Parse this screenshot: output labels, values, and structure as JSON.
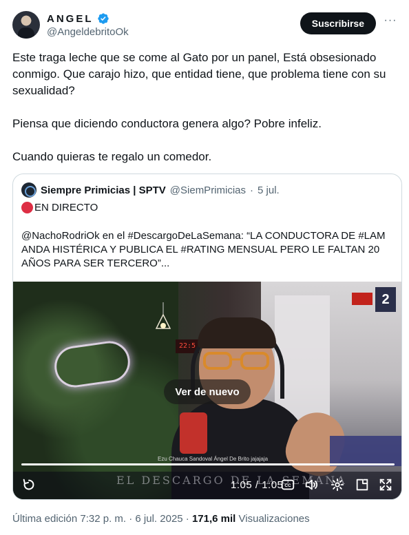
{
  "author": {
    "display_name": "ANGEL",
    "handle": "@AngeldebritoOk",
    "verified": true,
    "subscribe_label": "Suscribirse",
    "more_label": "···"
  },
  "tweet": {
    "paragraphs": [
      "Este traga leche que se come al Gato por un panel, Está obsesionado conmigo. Que carajo hizo, que entidad tiene, que problema tiene con su sexualidad?",
      "Piensa que diciendo conductora genera algo? Pobre infeliz.",
      "Cuando quieras te regalo un comedor."
    ]
  },
  "quote": {
    "name": "Siempre Primicias | SPTV",
    "handle": "@SiemPrimicias",
    "separator": "·",
    "date": "5 jul.",
    "live_label": "EN DIRECTO",
    "text": "@NachoRodriOk en el #DescargoDeLaSemana: “LA CONDUCTORA DE #LAM ANDA HISTÉRICA Y PUBLICA EL #RATING MENSUAL PERO LE FALTAN 20 AÑOS PARA SER TERCERO”...",
    "video": {
      "replay_label": "Ver de nuevo",
      "time": "1:05 / 1:05",
      "progress": 1.0,
      "overlay_title": "EL DESCARGO DE LA SEMANA",
      "clock_text": "22:5",
      "nametag": "Ezu Chauca Sandoval   Ángel De Brito jajajaja",
      "controls": [
        "replay-icon",
        "captions-icon",
        "volume-icon",
        "settings-icon",
        "popout-icon",
        "fullscreen-icon"
      ]
    }
  },
  "meta": {
    "edited": "Última edición 7:32 p. m. · 6 jul. 2025 ·",
    "views_count": "171,6 mil",
    "views_label": "Visualizaciones"
  },
  "colors": {
    "text": "#0f1419",
    "secondary": "#536471",
    "verified": "#1d9bf0",
    "live": "#dd2e44",
    "border": "#cfd9de"
  }
}
